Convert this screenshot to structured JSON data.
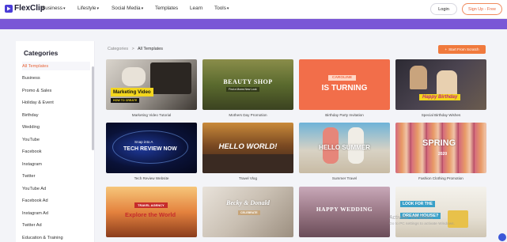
{
  "brand": {
    "logo_text": "FlexClip",
    "accent": "#7a57d6",
    "orange": "#f07a3d"
  },
  "nav": {
    "items": [
      "Business",
      "Lifestyle",
      "Social Media",
      "Templates",
      "Learn",
      "Tools"
    ],
    "login": "Login",
    "signup": "Sign Up - Free"
  },
  "sidebar": {
    "title": "Categories",
    "items": [
      "All Templates",
      "Business",
      "Promo & Sales",
      "Holiday & Event",
      "Birthday",
      "Wedding",
      "YouTube",
      "Facebook",
      "Instagram",
      "Twitter",
      "YouTube Ad",
      "Facebook Ad",
      "Instagram Ad",
      "Twitter Ad",
      "Education & Training"
    ]
  },
  "breadcrumb": {
    "root": "Categories",
    "sep": ">",
    "current": "All Templates"
  },
  "start_button": "Start From Scratch",
  "templates": [
    {
      "caption": "Marketing Video Tutorial",
      "thumb_text": "Marketing Video",
      "thumb_sub": "HOW TO CREATE"
    },
    {
      "caption": "Mothers Day Promotion",
      "thumb_text": "BEAUTY SHOP",
      "thumb_sub": "Find a Moms New Look"
    },
    {
      "caption": "Birthday Party Invitation",
      "thumb_text": "IS TURNING",
      "thumb_sub": "CAROLINE"
    },
    {
      "caption": "Special Birthday Wishes",
      "thumb_text": "Happy Birthday",
      "thumb_sub": ""
    },
    {
      "caption": "Tech Review Website",
      "thumb_text": "TECH REVIEW NOW",
      "thumb_sub": "Snap into A"
    },
    {
      "caption": "Travel Vlog",
      "thumb_text": "HELLO WORLD!",
      "thumb_sub": ""
    },
    {
      "caption": "Summer Travel",
      "thumb_text": "HELLO SUMMER",
      "thumb_sub": ""
    },
    {
      "caption": "Fashion Clothing Promotion",
      "thumb_text": "SPRING",
      "thumb_sub": "2020"
    },
    {
      "caption": "",
      "thumb_text": "Explore the World",
      "thumb_sub": "TRAVEL AGENCY"
    },
    {
      "caption": "",
      "thumb_text": "Becky & Donald",
      "thumb_sub": "CELEBRATE"
    },
    {
      "caption": "",
      "thumb_text": "HAPPY WEDDING",
      "thumb_sub": ""
    },
    {
      "caption": "",
      "thumb_text": "DREAM HOUSE?",
      "thumb_sub": "LOOK FOR THE"
    }
  ],
  "watermark": {
    "line1": "Activate Windows",
    "line2": "Go to PC settings to activate Windows."
  }
}
